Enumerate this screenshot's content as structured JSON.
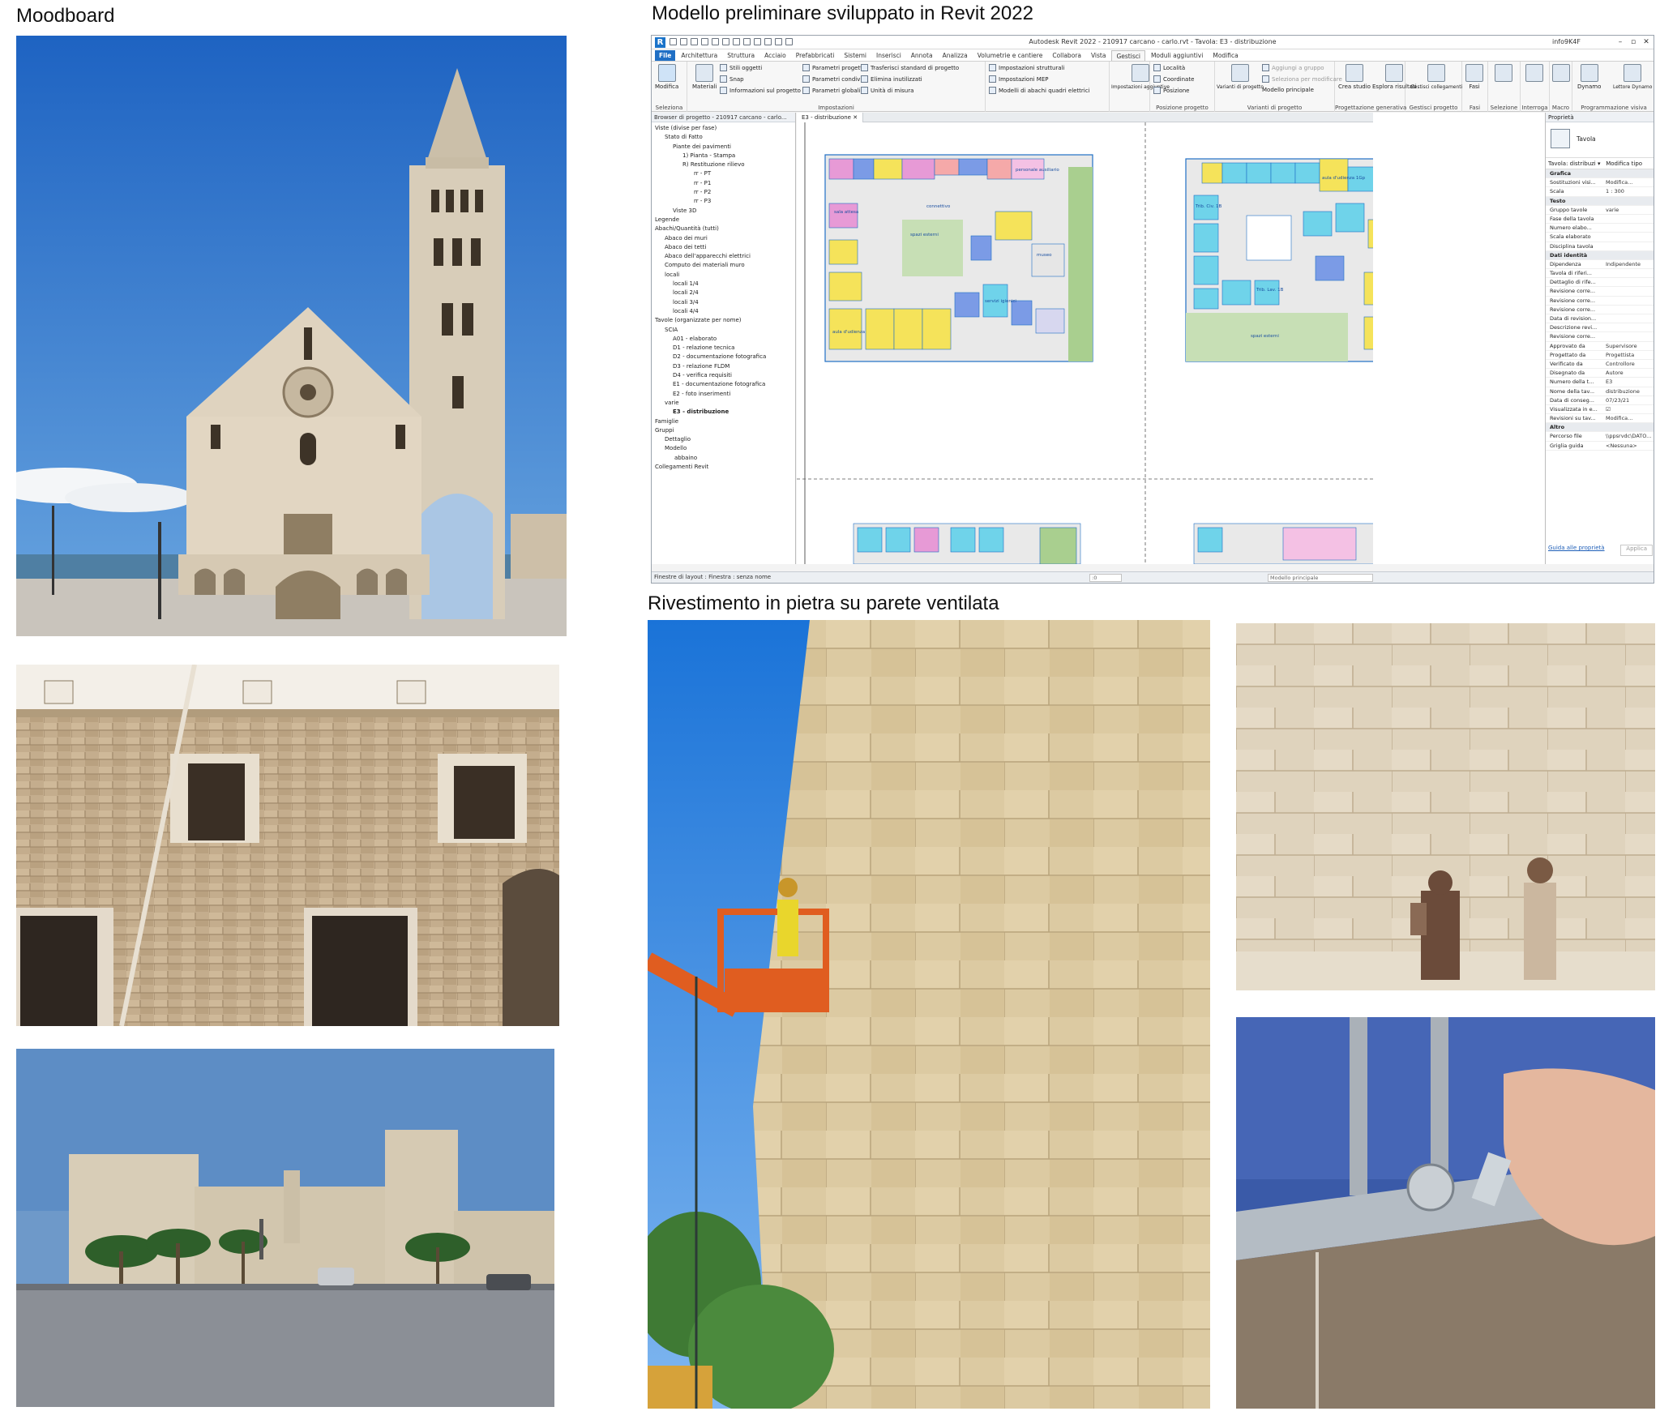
{
  "headings": {
    "moodboard": "Moodboard",
    "revit": "Modello preliminare sviluppato in Revit 2022",
    "cladding": "Rivestimento in pietra su parete ventilata"
  },
  "revit": {
    "window_title": "Autodesk Revit 2022 - 210917 carcano - carlo.rvt - Tavola: E3 - distribuzione",
    "user": "info9K4F",
    "tabs": [
      "File",
      "Architettura",
      "Struttura",
      "Acciaio",
      "Prefabbricati",
      "Sistemi",
      "Inserisci",
      "Annota",
      "Analizza",
      "Volumetrie e cantiere",
      "Collabora",
      "Vista",
      "Gestisci",
      "Moduli aggiuntivi",
      "Modifica"
    ],
    "active_tab": "Gestisci",
    "ribbon": {
      "select": {
        "modify": "Modifica",
        "group": "Seleziona"
      },
      "settings": {
        "materials": "Materiali",
        "object_styles": "Stili oggetti",
        "snap": "Snap",
        "project_info": "Informazioni sul progetto",
        "project_params": "Parametri progetto",
        "shared_params": "Parametri condivisi",
        "global_params": "Parametri globali",
        "transfer_standards": "Trasferisci standard di progetto",
        "purge": "Elimina inutilizzati",
        "units": "Unità di misura",
        "structural_settings": "Impostazioni strutturali",
        "mep_settings": "Impostazioni MEP",
        "schedule_models": "Modelli di abachi quadri elettrici",
        "additional_settings": "Impostazioni aggiuntive",
        "group": "Impostazioni"
      },
      "location": {
        "location": "Località",
        "coordinates": "Coordinate",
        "position": "Posizione",
        "group": "Posizione progetto"
      },
      "design_options": {
        "variants": "Varianti di progetto",
        "add_to_set": "Aggiungi a gruppo",
        "pick_to_edit": "Seleziona per modificare",
        "main_model": "Modello principale",
        "group": "Varianti di progetto"
      },
      "generative": {
        "create_study": "Crea studio",
        "explore": "Esplora risultati",
        "group": "Progettazione generativa"
      },
      "manage_project": {
        "manage_links": "Gestisci collegamenti",
        "group": "Gestisci progetto"
      },
      "phases": {
        "label": "Fasi",
        "group": "Fasi"
      },
      "selection": {
        "group": "Selezione"
      },
      "inquiry": {
        "group": "Interroga"
      },
      "macro": {
        "group": "Macro"
      },
      "visual_programming": {
        "dynamo": "Dynamo",
        "player": "Lettore Dynamo",
        "group": "Programmazione visiva"
      }
    },
    "browser": {
      "title": "Browser di progetto - 210917 carcano - carlo...",
      "items": [
        "Viste (divise per fase)",
        "Stato di Fatto",
        "Piante dei pavimenti",
        "1) Pianta - Stampa",
        "R) Restituzione rilievo",
        "rr - PT",
        "rr - P1",
        "rr - P2",
        "rr - P3",
        "Viste 3D",
        "Legende",
        "Abachi/Quantità (tutti)",
        "Abaco dei muri",
        "Abaco dei tetti",
        "Abaco dell'apparecchi elettrici",
        "Computo dei materiali muro",
        "locali",
        "locali 1/4",
        "locali 2/4",
        "locali 3/4",
        "locali 4/4",
        "Tavole (organizzate per nome)",
        "SCIA",
        "A01 - elaborato",
        "D1 - relazione tecnica",
        "D2 - documentazione fotografica",
        "D3 - relazione FLDM",
        "D4 - verifica requisiti",
        "E1 - documentazione fotografica",
        "E2 - foto inserimenti",
        "varie",
        "E3 - distribuzione",
        "Famiglie",
        "Gruppi",
        "Dettaglio",
        "Modello",
        "abbaino",
        "Collegamenti Revit"
      ]
    },
    "view_tab": "E3 - distribuzione",
    "properties": {
      "title": "Proprietà",
      "type": "Tavola",
      "selector": "Tavola: distribuzi",
      "edit_type": "Modifica tipo",
      "rows": [
        {
          "k": "Grafica",
          "v": "",
          "grp": true
        },
        {
          "k": "Sostituzioni visi...",
          "v": "Modifica..."
        },
        {
          "k": "Scala",
          "v": "1 : 300"
        },
        {
          "k": "Testo",
          "v": "",
          "grp": true
        },
        {
          "k": "Gruppo tavole",
          "v": "varie"
        },
        {
          "k": "Fase della tavola",
          "v": ""
        },
        {
          "k": "Numero elabo...",
          "v": ""
        },
        {
          "k": "Scala elaborato",
          "v": ""
        },
        {
          "k": "Disciplina tavola",
          "v": ""
        },
        {
          "k": "Dati identità",
          "v": "",
          "grp": true
        },
        {
          "k": "Dipendenza",
          "v": "Indipendente"
        },
        {
          "k": "Tavola di riferi...",
          "v": ""
        },
        {
          "k": "Dettaglio di rife...",
          "v": ""
        },
        {
          "k": "Revisione corre...",
          "v": ""
        },
        {
          "k": "Revisione corre...",
          "v": ""
        },
        {
          "k": "Revisione corre...",
          "v": ""
        },
        {
          "k": "Data di revision...",
          "v": ""
        },
        {
          "k": "Descrizione revi...",
          "v": ""
        },
        {
          "k": "Revisione corre...",
          "v": ""
        },
        {
          "k": "Approvato da",
          "v": "Supervisore"
        },
        {
          "k": "Progettato da",
          "v": "Progettista"
        },
        {
          "k": "Verificato da",
          "v": "Controllore"
        },
        {
          "k": "Disegnato da",
          "v": "Autore"
        },
        {
          "k": "Numero della t...",
          "v": "E3"
        },
        {
          "k": "Nome della tav...",
          "v": "distribuzione"
        },
        {
          "k": "Data di conseg...",
          "v": "07/23/21"
        },
        {
          "k": "Visualizzata in e...",
          "v": "☑"
        },
        {
          "k": "Revisioni su tav...",
          "v": "Modifica..."
        },
        {
          "k": "Altro",
          "v": "",
          "grp": true
        },
        {
          "k": "Percorso file",
          "v": "\\\\ppsrvdc\\DATO..."
        },
        {
          "k": "Griglia guida",
          "v": "<Nessuna>"
        }
      ],
      "help_link": "Guida alle proprietà",
      "apply": "Applica"
    },
    "status": {
      "text": "Finestre di layout : Finestra : senza nome",
      "model": "Modello principale",
      "zero": ":0"
    },
    "plan_labels": [
      "sala attesa",
      "connettivo",
      "spazi esterni",
      "aula d'udienza",
      "museo",
      "servizi igienici",
      "Trib. Civ. 1B",
      "Trib. Lav. 1B",
      "personale ausiliario",
      "spazi esterni",
      "aula d'udienza 1Gp"
    ]
  },
  "colors": {
    "revit_blue": "#1f6fc5",
    "plan_yellow": "#f5e35a",
    "plan_cyan": "#6fd3ea",
    "plan_green": "#a9cf8f",
    "plan_pink": "#e79ad6",
    "plan_blue": "#7b9be6"
  }
}
